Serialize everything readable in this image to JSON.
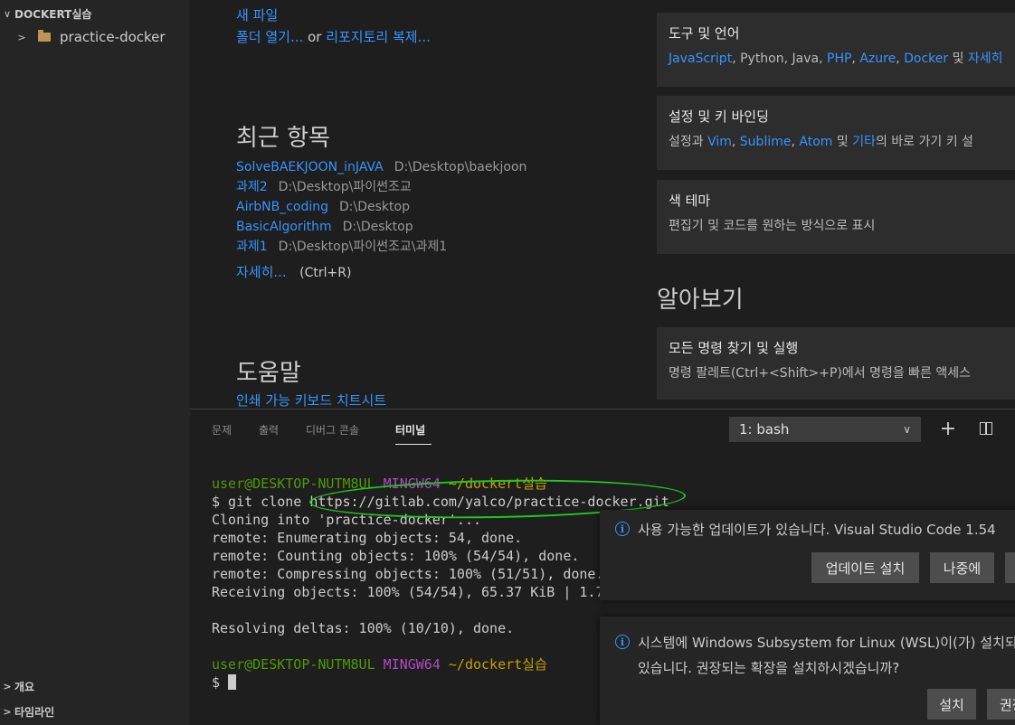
{
  "sidebar": {
    "explorer_title": "DOCKERT실습",
    "folder_name": "practice-docker",
    "outline_label": "개요",
    "timeline_label": "타임라인"
  },
  "welcome": {
    "start": {
      "new_file": "새 파일",
      "open_folder": "폴더 열기...",
      "or_text": "or",
      "clone_repo": "리포지토리 복제..."
    },
    "recent": {
      "heading": "최근 항목",
      "items": [
        {
          "name": "SolveBAEKJOON_inJAVA",
          "path": "D:\\Desktop\\baekjoon"
        },
        {
          "name": "과제2",
          "path": "D:\\Desktop\\파이썬조교"
        },
        {
          "name": "AirbNB_coding",
          "path": "D:\\Desktop"
        },
        {
          "name": "BasicAlgorithm",
          "path": "D:\\Desktop"
        },
        {
          "name": "과제1",
          "path": "D:\\Desktop\\파이썬조교\\과제1"
        }
      ],
      "more_label": "자세히...",
      "more_shortcut": "(Ctrl+R)"
    },
    "help": {
      "heading": "도움말",
      "cheatsheet": "인쇄 가능 키보드 치트시트"
    },
    "customize_cards": {
      "tools": {
        "title": "도구 및 언어",
        "links": [
          "JavaScript",
          "Python, Java, ",
          "PHP",
          "Azure",
          "Docker",
          " 및 ",
          "자세히"
        ]
      },
      "settings": {
        "title": "설정 및 키 바인딩",
        "prefix": "설정과 ",
        "vim": "Vim",
        "sublime": "Sublime",
        "atom": "Atom",
        "mid": " 및 ",
        "other": "기타",
        "suffix": "의 바로 가기 키 설"
      },
      "theme": {
        "title": "색 테마",
        "desc": "편집기 및 코드를 원하는 방식으로 표시"
      }
    },
    "learn": {
      "heading": "알아보기",
      "card_title": "모든 명령 찾기 및 실행",
      "card_desc": "명령 팔레트(Ctrl+<Shift>+P)에서 명령을 빠른 액세스"
    }
  },
  "panel": {
    "tabs": [
      "문제",
      "출력",
      "디버그 콘솔",
      "터미널"
    ],
    "active_tab": "터미널",
    "terminal_select": "1: bash",
    "add_icon": "plus-icon",
    "split_icon": "split-terminal-icon"
  },
  "terminal": {
    "user_host": "user@DESKTOP-NUTM8UL",
    "env": "MINGW64",
    "cwd": "~/dockert실습",
    "command": "$ git clone https://gitlab.com/yalco/practice-docker.git",
    "output": [
      "Cloning into 'practice-docker'...",
      "remote: Enumerating objects: 54, done.",
      "remote: Counting objects: 100% (54/54), done.",
      "remote: Compressing objects: 100% (51/51), done.",
      "Receiving objects: 100% (54/54), 65.37 KiB | 1.7",
      "",
      "Resolving deltas: 100% (10/10), done."
    ],
    "prompt": "$ "
  },
  "notifications": {
    "update": {
      "message": "사용 가능한 업데이트가 있습니다. Visual Studio Code 1.54",
      "install": "업데이트 설치",
      "later": "나중에"
    },
    "wsl": {
      "line1": "시스템에 Windows Subsystem for Linux (WSL)이(가) 설치되",
      "line2": "있습니다. 권장되는 확장을 설치하시겠습니까?",
      "install": "설치",
      "other": "권장"
    }
  },
  "colors": {
    "link": "#3794ff",
    "annotation": "#1ec81e",
    "term_user": "#4e9a06",
    "term_env": "#b148c6",
    "term_dir": "#c4a000"
  }
}
